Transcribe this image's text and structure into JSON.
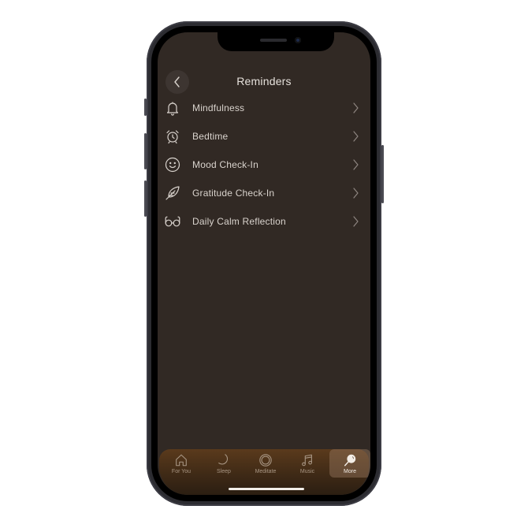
{
  "header": {
    "title": "Reminders",
    "back_icon": "chevron-left-icon"
  },
  "reminders": [
    {
      "label": "Mindfulness",
      "icon": "bell-icon"
    },
    {
      "label": "Bedtime",
      "icon": "alarm-clock-icon"
    },
    {
      "label": "Mood Check-In",
      "icon": "smiley-icon"
    },
    {
      "label": "Gratitude Check-In",
      "icon": "feather-icon"
    },
    {
      "label": "Daily Calm Reflection",
      "icon": "glasses-icon"
    }
  ],
  "tabbar": {
    "tabs": [
      {
        "label": "For You",
        "icon": "home-icon",
        "active": false
      },
      {
        "label": "Sleep",
        "icon": "moon-icon",
        "active": false
      },
      {
        "label": "Meditate",
        "icon": "circle-icon",
        "active": false
      },
      {
        "label": "Music",
        "icon": "music-note-icon",
        "active": false
      },
      {
        "label": "More",
        "icon": "magnifier-icon",
        "active": true
      }
    ]
  },
  "colors": {
    "background": "#312924",
    "text": "#d9d3cd",
    "tabbar_top": "#5a3a1c",
    "tabbar_bottom": "#2b1e12"
  }
}
